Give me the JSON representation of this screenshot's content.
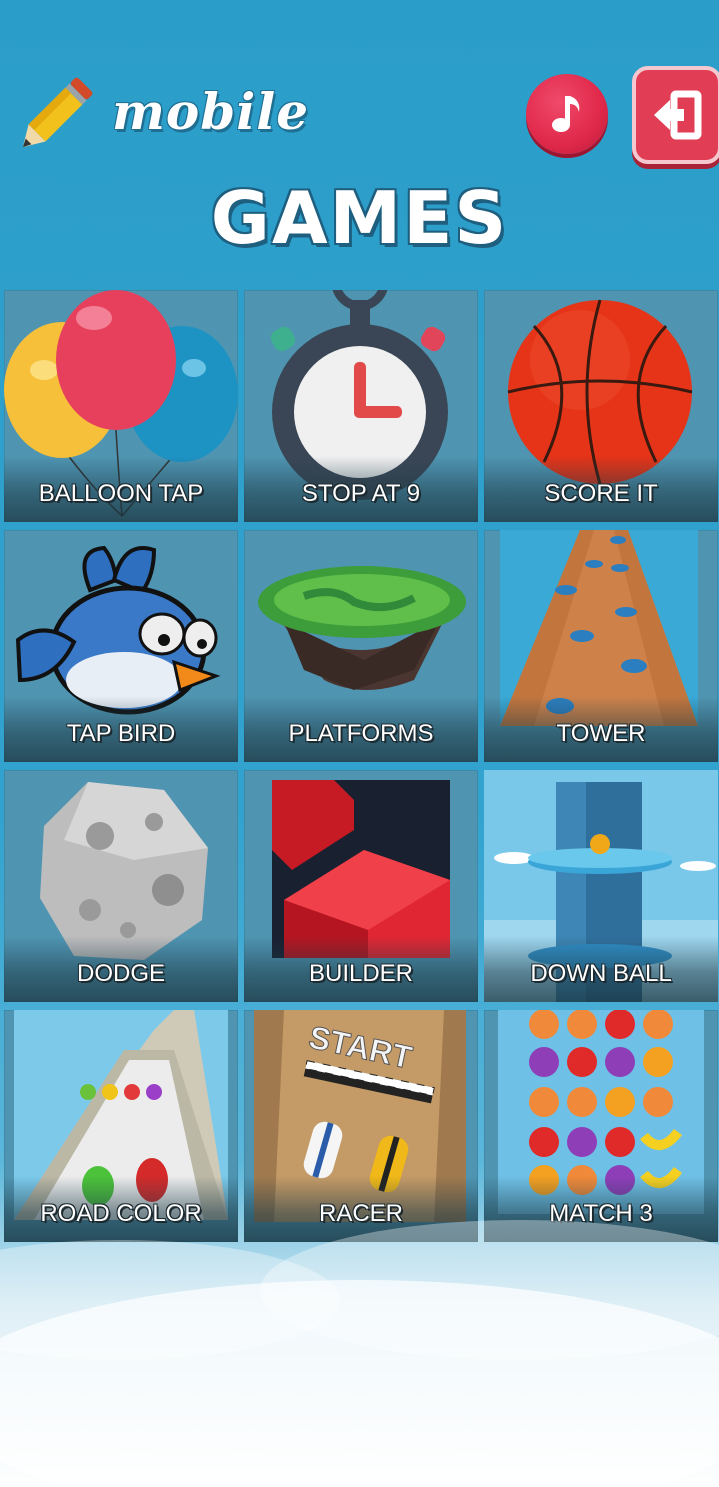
{
  "header": {
    "logo_top": "mobile",
    "logo_bottom": "GAMES",
    "music_button_icon": "music-note-icon",
    "exit_button_icon": "exit-door-icon"
  },
  "games": [
    {
      "label": "BALLOON TAP",
      "icon": "balloons-icon"
    },
    {
      "label": "STOP AT 9",
      "icon": "stopwatch-icon"
    },
    {
      "label": "SCORE IT",
      "icon": "basketball-icon"
    },
    {
      "label": "TAP BIRD",
      "icon": "blue-bird-icon"
    },
    {
      "label": "PLATFORMS",
      "icon": "floating-island-icon"
    },
    {
      "label": "TOWER",
      "icon": "brick-tower-icon"
    },
    {
      "label": "DODGE",
      "icon": "asteroid-icon"
    },
    {
      "label": "BUILDER",
      "icon": "red-blocks-icon"
    },
    {
      "label": "DOWN BALL",
      "icon": "helix-tower-icon"
    },
    {
      "label": "ROAD COLOR",
      "icon": "color-road-icon"
    },
    {
      "label": "RACER",
      "icon": "race-cars-icon"
    },
    {
      "label": "MATCH 3",
      "icon": "fruits-grid-icon"
    }
  ],
  "start_sign": "START",
  "colors": {
    "background": "#2b9dc9",
    "tile": "#4f95b2",
    "music_button": "#e0284a",
    "exit_button": "#e13e55"
  }
}
